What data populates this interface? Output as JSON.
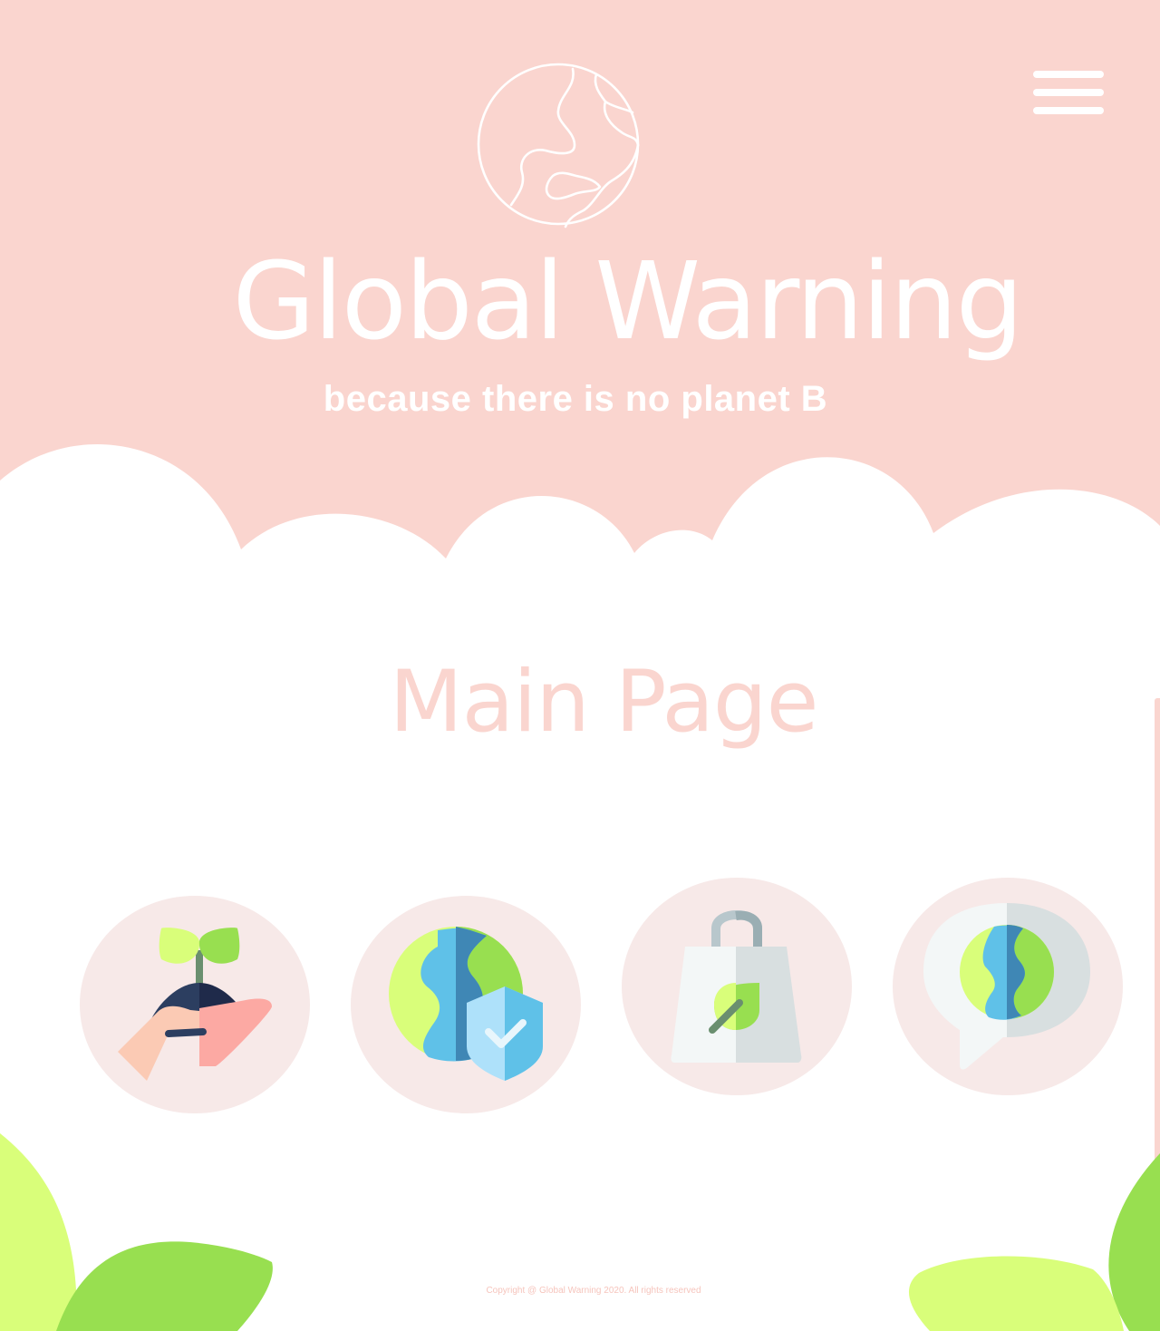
{
  "brand": {
    "title": "Global Warning",
    "tagline": "because there is no planet B",
    "logo_icon": "globe-outline-icon"
  },
  "nav": {
    "menu_icon": "hamburger-menu-icon"
  },
  "main": {
    "heading": "Main Page",
    "features": [
      {
        "icon": "hand-holding-seedling-icon"
      },
      {
        "icon": "earth-with-shield-icon"
      },
      {
        "icon": "eco-shopping-bag-icon"
      },
      {
        "icon": "earth-speech-bubble-icon"
      }
    ]
  },
  "footer": {
    "copyright": "Copyright @ Global Warning 2020. All rights reserved"
  },
  "colors": {
    "header_bg": "#fad5cf",
    "heading": "#fad5cf",
    "feature_circle": "#f7e9e8",
    "leaf_light": "#d9fe7a",
    "leaf_green": "#98df50",
    "earth_blue": "#5fc1e8",
    "earth_dark_blue": "#3f87b5"
  }
}
